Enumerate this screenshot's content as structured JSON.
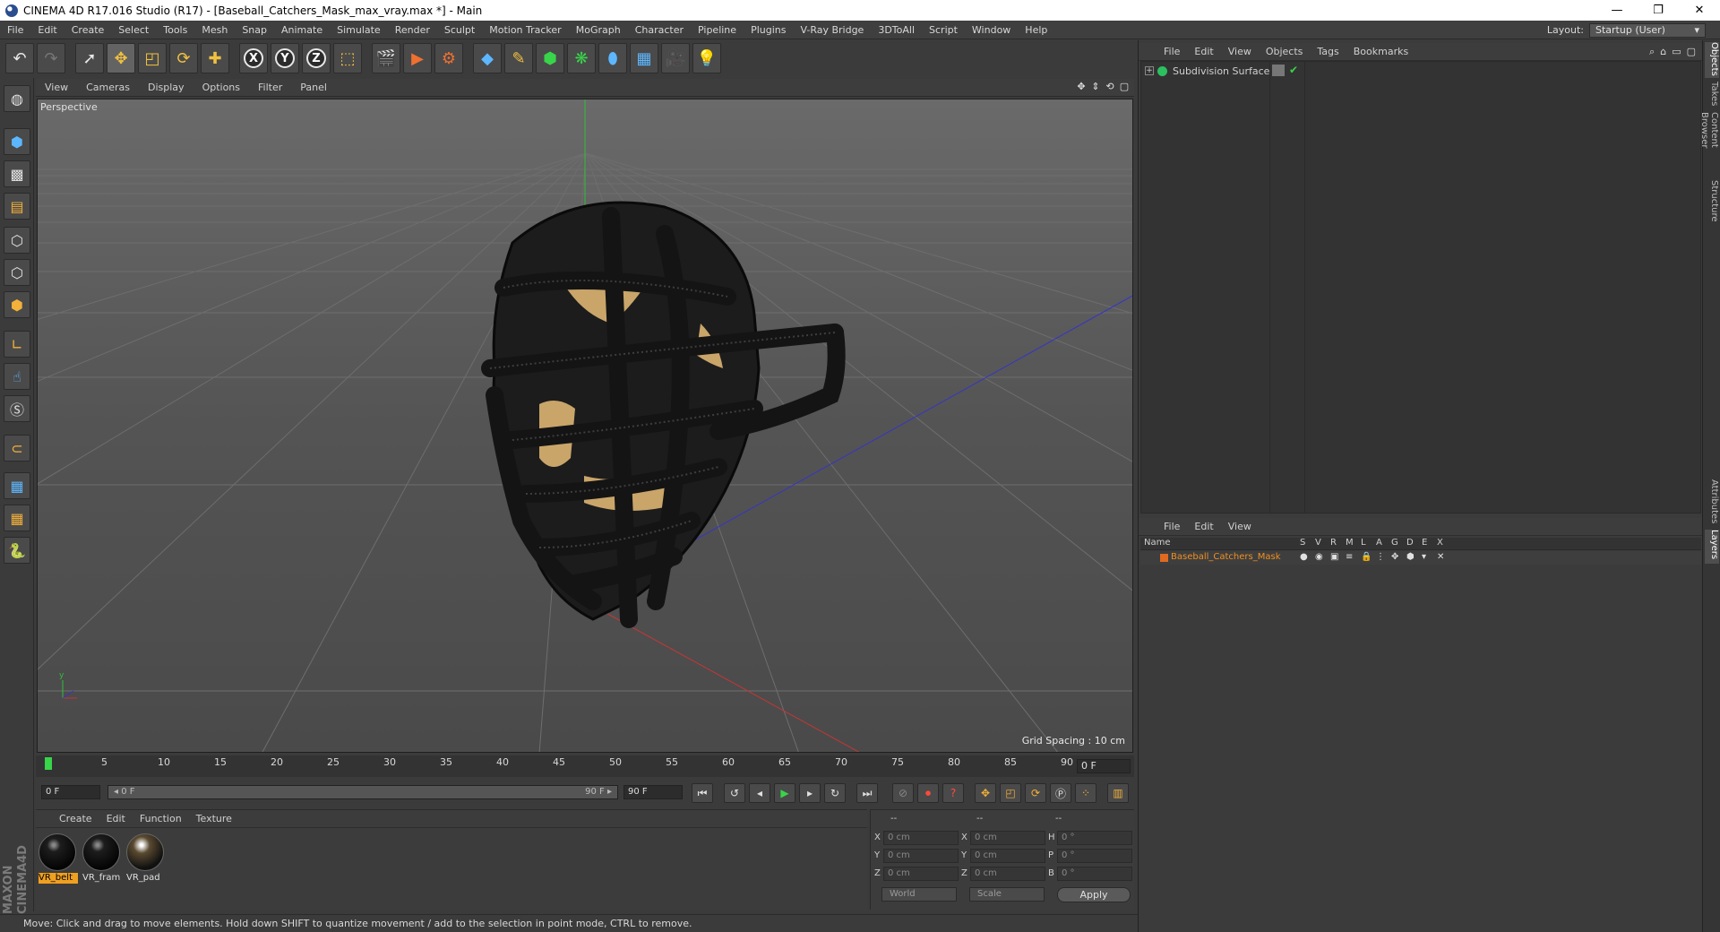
{
  "window": {
    "title": "CINEMA 4D R17.016 Studio (R17) - [Baseball_Catchers_Mask_max_vray.max *] - Main",
    "minimize": "—",
    "restore": "❐",
    "close": "✕"
  },
  "menubar": [
    "File",
    "Edit",
    "Create",
    "Select",
    "Tools",
    "Mesh",
    "Snap",
    "Animate",
    "Simulate",
    "Render",
    "Sculpt",
    "Motion Tracker",
    "MoGraph",
    "Character",
    "Pipeline",
    "Plugins",
    "V-Ray Bridge",
    "3DToAll",
    "Script",
    "Window",
    "Help"
  ],
  "layout": {
    "label": "Layout:",
    "value": "Startup (User)"
  },
  "toolbar": {
    "icons": [
      "undo-icon",
      "redo-icon",
      "live-selection-icon",
      "move-icon",
      "scale-icon",
      "rotate-icon",
      "add-icon",
      "x-axis-icon",
      "y-axis-icon",
      "z-axis-icon",
      "world-coordinates-icon",
      "render-view-icon",
      "render-picture-viewer-icon",
      "edit-render-settings-icon",
      "cube-icon",
      "pen-spline-icon",
      "subdivision-surface-icon",
      "array-icon",
      "deformer-icon",
      "floor-icon",
      "camera-icon",
      "light-icon"
    ],
    "axis_x": "X",
    "axis_y": "Y",
    "axis_z": "Z"
  },
  "viewport": {
    "menu": [
      "View",
      "Cameras",
      "Display",
      "Options",
      "Filter",
      "Panel"
    ],
    "camera_label": "Perspective",
    "grid_spacing": "Grid Spacing : 10 cm"
  },
  "timeline": {
    "ticks": [
      "0",
      "5",
      "10",
      "15",
      "20",
      "25",
      "30",
      "35",
      "40",
      "45",
      "50",
      "55",
      "60",
      "65",
      "70",
      "75",
      "80",
      "85",
      "90"
    ],
    "current_frame": "0 F"
  },
  "transport": {
    "start_frame": "0 F",
    "range_start": "◂ 0 F",
    "range_end": "90 F ▸",
    "end_frame": "90 F"
  },
  "materials": {
    "menu": [
      "Create",
      "Edit",
      "Function",
      "Texture"
    ],
    "items": [
      "VR_belt",
      "VR_fram",
      "VR_pad"
    ]
  },
  "coordinates": {
    "header": [
      "--",
      "--",
      "--"
    ],
    "rows": [
      {
        "a": "X",
        "v1": "0 cm",
        "b": "X",
        "v2": "0 cm",
        "c": "H",
        "v3": "0 °"
      },
      {
        "a": "Y",
        "v1": "0 cm",
        "b": "Y",
        "v2": "0 cm",
        "c": "P",
        "v3": "0 °"
      },
      {
        "a": "Z",
        "v1": "0 cm",
        "b": "Z",
        "v2": "0 cm",
        "c": "B",
        "v3": "0 °"
      }
    ],
    "mode": "World",
    "scale": "Scale",
    "apply": "Apply"
  },
  "status": "Move: Click and drag to move elements. Hold down SHIFT to quantize movement / add to the selection in point mode, CTRL to remove.",
  "objects_panel": {
    "menu": [
      "File",
      "Edit",
      "View",
      "Objects",
      "Tags",
      "Bookmarks"
    ],
    "object_name": "Subdivision Surface"
  },
  "layers_panel": {
    "menu": [
      "File",
      "Edit",
      "View"
    ],
    "columns": [
      "Name",
      "S",
      "V",
      "R",
      "M",
      "L",
      "A",
      "G",
      "D",
      "E",
      "X"
    ],
    "layer_name": "Baseball_Catchers_Mask"
  },
  "side_tabs": [
    "Objects",
    "Takes",
    "Content Browser",
    "Structure",
    "Attributes",
    "Layers"
  ]
}
